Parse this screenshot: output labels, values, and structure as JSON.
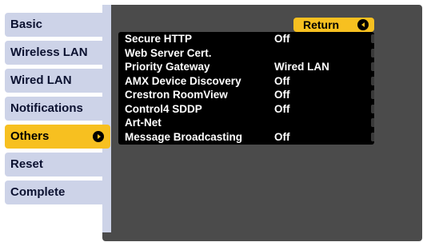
{
  "menu": {
    "items": [
      {
        "label": "Basic"
      },
      {
        "label": "Wireless LAN"
      },
      {
        "label": "Wired LAN"
      },
      {
        "label": "Notifications"
      },
      {
        "label": "Others",
        "selected": true
      },
      {
        "label": "Reset"
      },
      {
        "label": "Complete"
      }
    ]
  },
  "submenu": {
    "return_label": "Return",
    "rows": [
      {
        "label": "Secure HTTP",
        "value": "Off"
      },
      {
        "label": "Web Server Cert.",
        "value": ""
      },
      {
        "label": "Priority Gateway",
        "value": "Wired LAN"
      },
      {
        "label": "AMX Device Discovery",
        "value": "Off"
      },
      {
        "label": "Crestron RoomView",
        "value": "Off"
      },
      {
        "label": "Control4 SDDP",
        "value": "Off"
      },
      {
        "label": "Art-Net",
        "value": ""
      },
      {
        "label": "Message Broadcasting",
        "value": "Off"
      }
    ]
  },
  "colors": {
    "selected_tab": "#f7c020",
    "tab": "#cdd3e8",
    "panel": "#4b4b4b",
    "list_background": "#000000"
  },
  "icons": {
    "selected_tab": "arrow-right-icon",
    "return": "arrow-left-icon"
  }
}
